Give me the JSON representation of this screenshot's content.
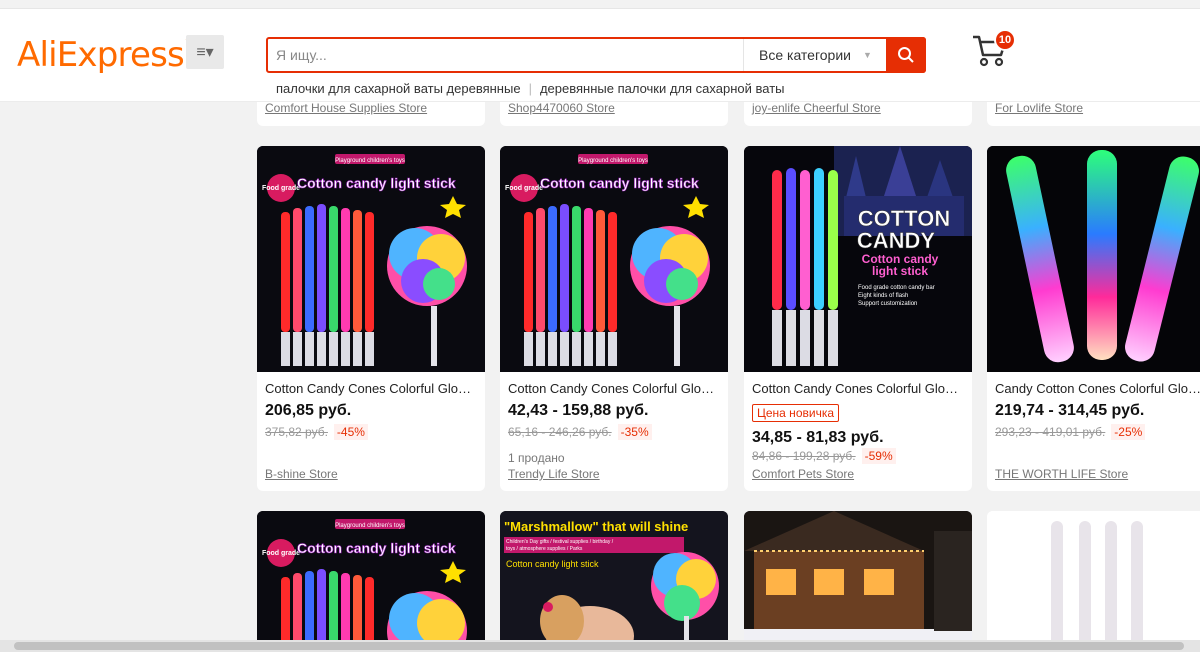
{
  "header": {
    "logo": "AliExpress",
    "logo_tm": "™",
    "search_placeholder": "Я ищу...",
    "category": "Все категории",
    "suggestions": [
      "палочки для сахарной ваты деревянные",
      "деревянные палочки для сахарной ваты"
    ],
    "cart_count": "10"
  },
  "prev_row_stores": [
    "Comfort House Supplies Store",
    "Shop4470060 Store",
    "joy-enlife Cheerful Store",
    "For Lovlife Store"
  ],
  "products": [
    {
      "title": "Cotton Candy Cones Colorful Glow…",
      "price": "206,85 руб.",
      "old_price": "375,82 руб.",
      "discount": "-45%",
      "store": "B-shine Store",
      "image": {
        "banner": "Playground children's toys",
        "headline": "Cotton candy light stick",
        "badge": "Food grade"
      }
    },
    {
      "title": "Cotton Candy Cones Colorful Glow…",
      "price": "42,43 - 159,88 руб.",
      "old_price": "65,16 - 246,26 руб.",
      "discount": "-35%",
      "sold": "1 продано",
      "store": "Trendy Life Store",
      "image": {
        "banner": "Playground children's toys",
        "headline": "Cotton candy light stick",
        "badge": "Food grade"
      }
    },
    {
      "title": "Cotton Candy Cones Colorful Glow…",
      "newcomer": "Цена новичка",
      "price": "34,85 - 81,83 руб.",
      "old_price": "84,86 - 199,28 руб.",
      "discount": "-59%",
      "store": "Comfort Pets Store",
      "image": {
        "line1": "COTTON",
        "line2": "CANDY",
        "line3": "Cotton candy",
        "line4": "light stick",
        "features": [
          "Food grade cotton candy bar",
          "Eight kinds of flash",
          "Support customization"
        ]
      }
    },
    {
      "title": "Candy Cotton Cones Colorful Glow…",
      "price": "219,74 - 314,45 руб.",
      "old_price": "293,23 - 419,01 руб.",
      "discount": "-25%",
      "store": "THE WORTH LIFE Store"
    }
  ],
  "next_row": [
    {
      "image": {
        "banner": "Playground children's toys",
        "headline": "Cotton candy light stick",
        "badge": "Food grade"
      }
    },
    {
      "image": {
        "headline": "\"Marshmallow\" that will shine",
        "sub": "Children's Day gifts / festival supplies / birthday / toys / atmosphere supplies / Parks",
        "label": "Cotton candy light stick"
      }
    },
    {
      "image": {}
    },
    {
      "image": {}
    }
  ],
  "colors": {
    "accent": "#e62e04",
    "brand": "#ff6a00"
  }
}
